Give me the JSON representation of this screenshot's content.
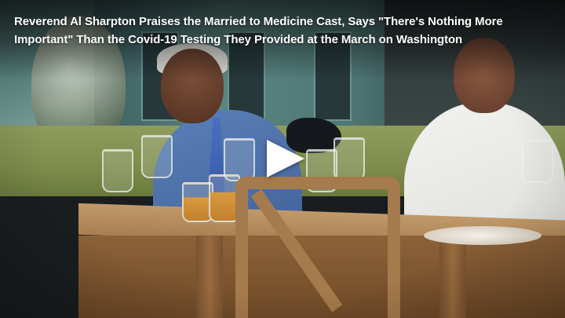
{
  "video": {
    "title": "Reverend Al Sharpton Praises the Married to Medicine Cast, Says \"There's Nothing More Important\" Than the Covid-19 Testing They Provided at the March on Washington",
    "play_icon": "play-icon",
    "title_color": "#ffffff"
  }
}
